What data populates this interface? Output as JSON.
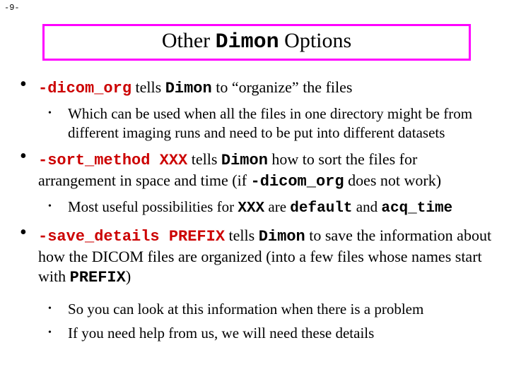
{
  "page_number": "-9-",
  "title": {
    "pre": "Other ",
    "prog": "Dimon",
    "post": " Options"
  },
  "b1": {
    "opt": "-dicom_org",
    "mid": " tells ",
    "prog": "Dimon",
    "post": " to “organize” the files"
  },
  "b1a": "Which can be used when all the files in one directory might be from different imaging runs and need to be put into different datasets",
  "b2": {
    "opt": "-sort_method XXX",
    "mid": " tells ",
    "prog": "Dimon",
    "mid2": " how to sort the files for arrangement in space and time (if ",
    "ref": "-dicom_org",
    "post": " does not work)"
  },
  "b2a": {
    "pre": "Most useful possibilities for ",
    "xxx": "XXX",
    "mid": " are ",
    "v1": "default",
    "and": " and ",
    "v2": "acq_time"
  },
  "b3": {
    "opt": "-save_details PREFIX",
    "mid": "  tells ",
    "prog": "Dimon",
    "mid2": " to save the information about how the DICOM files are organized (into a few files whose names start with ",
    "ref": "PREFIX",
    "post": ")"
  },
  "b3a": "So you can look at this information when there is a problem",
  "b3b": "If you need help from us, we will need these details"
}
